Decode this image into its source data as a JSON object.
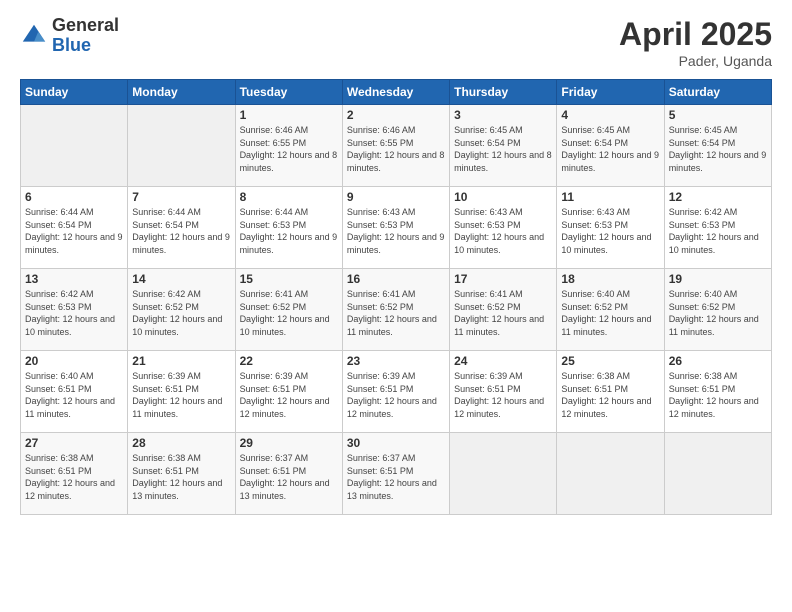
{
  "logo": {
    "general": "General",
    "blue": "Blue"
  },
  "title": {
    "month_year": "April 2025",
    "location": "Pader, Uganda"
  },
  "weekdays": [
    "Sunday",
    "Monday",
    "Tuesday",
    "Wednesday",
    "Thursday",
    "Friday",
    "Saturday"
  ],
  "weeks": [
    [
      {
        "day": "",
        "info": ""
      },
      {
        "day": "",
        "info": ""
      },
      {
        "day": "1",
        "info": "Sunrise: 6:46 AM\nSunset: 6:55 PM\nDaylight: 12 hours and 8 minutes."
      },
      {
        "day": "2",
        "info": "Sunrise: 6:46 AM\nSunset: 6:55 PM\nDaylight: 12 hours and 8 minutes."
      },
      {
        "day": "3",
        "info": "Sunrise: 6:45 AM\nSunset: 6:54 PM\nDaylight: 12 hours and 8 minutes."
      },
      {
        "day": "4",
        "info": "Sunrise: 6:45 AM\nSunset: 6:54 PM\nDaylight: 12 hours and 9 minutes."
      },
      {
        "day": "5",
        "info": "Sunrise: 6:45 AM\nSunset: 6:54 PM\nDaylight: 12 hours and 9 minutes."
      }
    ],
    [
      {
        "day": "6",
        "info": "Sunrise: 6:44 AM\nSunset: 6:54 PM\nDaylight: 12 hours and 9 minutes."
      },
      {
        "day": "7",
        "info": "Sunrise: 6:44 AM\nSunset: 6:54 PM\nDaylight: 12 hours and 9 minutes."
      },
      {
        "day": "8",
        "info": "Sunrise: 6:44 AM\nSunset: 6:53 PM\nDaylight: 12 hours and 9 minutes."
      },
      {
        "day": "9",
        "info": "Sunrise: 6:43 AM\nSunset: 6:53 PM\nDaylight: 12 hours and 9 minutes."
      },
      {
        "day": "10",
        "info": "Sunrise: 6:43 AM\nSunset: 6:53 PM\nDaylight: 12 hours and 10 minutes."
      },
      {
        "day": "11",
        "info": "Sunrise: 6:43 AM\nSunset: 6:53 PM\nDaylight: 12 hours and 10 minutes."
      },
      {
        "day": "12",
        "info": "Sunrise: 6:42 AM\nSunset: 6:53 PM\nDaylight: 12 hours and 10 minutes."
      }
    ],
    [
      {
        "day": "13",
        "info": "Sunrise: 6:42 AM\nSunset: 6:53 PM\nDaylight: 12 hours and 10 minutes."
      },
      {
        "day": "14",
        "info": "Sunrise: 6:42 AM\nSunset: 6:52 PM\nDaylight: 12 hours and 10 minutes."
      },
      {
        "day": "15",
        "info": "Sunrise: 6:41 AM\nSunset: 6:52 PM\nDaylight: 12 hours and 10 minutes."
      },
      {
        "day": "16",
        "info": "Sunrise: 6:41 AM\nSunset: 6:52 PM\nDaylight: 12 hours and 11 minutes."
      },
      {
        "day": "17",
        "info": "Sunrise: 6:41 AM\nSunset: 6:52 PM\nDaylight: 12 hours and 11 minutes."
      },
      {
        "day": "18",
        "info": "Sunrise: 6:40 AM\nSunset: 6:52 PM\nDaylight: 12 hours and 11 minutes."
      },
      {
        "day": "19",
        "info": "Sunrise: 6:40 AM\nSunset: 6:52 PM\nDaylight: 12 hours and 11 minutes."
      }
    ],
    [
      {
        "day": "20",
        "info": "Sunrise: 6:40 AM\nSunset: 6:51 PM\nDaylight: 12 hours and 11 minutes."
      },
      {
        "day": "21",
        "info": "Sunrise: 6:39 AM\nSunset: 6:51 PM\nDaylight: 12 hours and 11 minutes."
      },
      {
        "day": "22",
        "info": "Sunrise: 6:39 AM\nSunset: 6:51 PM\nDaylight: 12 hours and 12 minutes."
      },
      {
        "day": "23",
        "info": "Sunrise: 6:39 AM\nSunset: 6:51 PM\nDaylight: 12 hours and 12 minutes."
      },
      {
        "day": "24",
        "info": "Sunrise: 6:39 AM\nSunset: 6:51 PM\nDaylight: 12 hours and 12 minutes."
      },
      {
        "day": "25",
        "info": "Sunrise: 6:38 AM\nSunset: 6:51 PM\nDaylight: 12 hours and 12 minutes."
      },
      {
        "day": "26",
        "info": "Sunrise: 6:38 AM\nSunset: 6:51 PM\nDaylight: 12 hours and 12 minutes."
      }
    ],
    [
      {
        "day": "27",
        "info": "Sunrise: 6:38 AM\nSunset: 6:51 PM\nDaylight: 12 hours and 12 minutes."
      },
      {
        "day": "28",
        "info": "Sunrise: 6:38 AM\nSunset: 6:51 PM\nDaylight: 12 hours and 13 minutes."
      },
      {
        "day": "29",
        "info": "Sunrise: 6:37 AM\nSunset: 6:51 PM\nDaylight: 12 hours and 13 minutes."
      },
      {
        "day": "30",
        "info": "Sunrise: 6:37 AM\nSunset: 6:51 PM\nDaylight: 12 hours and 13 minutes."
      },
      {
        "day": "",
        "info": ""
      },
      {
        "day": "",
        "info": ""
      },
      {
        "day": "",
        "info": ""
      }
    ]
  ]
}
